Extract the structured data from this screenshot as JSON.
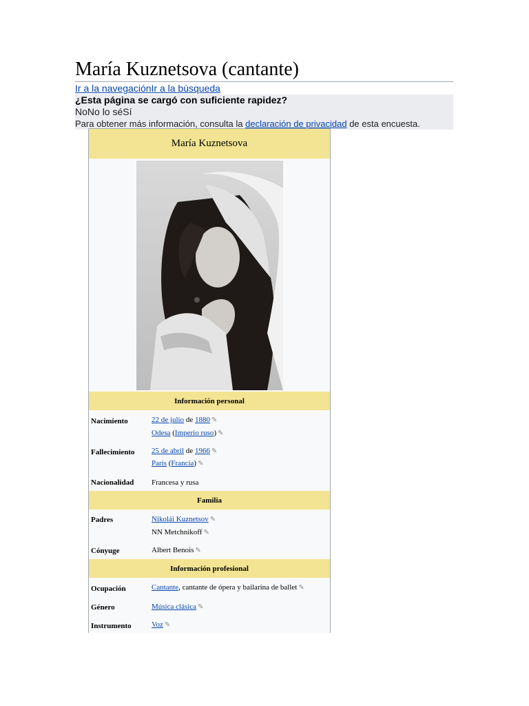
{
  "page": {
    "title": "María Kuznetsova (cantante)",
    "skip_nav": "Ir a la navegación",
    "skip_search": "Ir a la búsqueda"
  },
  "survey": {
    "question": "¿Esta página se cargó con suficiente rapidez?",
    "options": [
      "No",
      "No lo sé",
      "Sí"
    ],
    "note_before": "Para obtener más información, consulta la ",
    "note_link": "declaración de privacidad",
    "note_after": " de esta encuesta."
  },
  "infobox": {
    "title": "María Kuznetsova",
    "sections": {
      "personal": "Información personal",
      "family": "Familia",
      "professional": "Información profesional"
    },
    "nacimiento": {
      "label": "Nacimiento",
      "date_link": "22 de julio",
      "date_sep": " de ",
      "year_link": "1880",
      "place_link": "Odesa",
      "place_open": " (",
      "country_link": "Imperio ruso",
      "place_close": ")"
    },
    "fallecimiento": {
      "label": "Fallecimiento",
      "date_link": "25 de abril",
      "date_sep": " de ",
      "year_link": "1966",
      "place_link": "París",
      "place_open": " (",
      "country_link": "Francia",
      "place_close": ")"
    },
    "nacionalidad": {
      "label": "Nacionalidad",
      "value": "Francesa y rusa"
    },
    "padres": {
      "label": "Padres",
      "father_link": "Nikolái Kuznetsov",
      "mother": "NN Metchnikoff"
    },
    "conyuge": {
      "label": "Cónyuge",
      "value": "Albert Benois"
    },
    "ocupacion": {
      "label": "Ocupación",
      "link": "Cantante",
      "rest": ", cantante de ópera y bailarina de ballet"
    },
    "genero": {
      "label": "Género",
      "link": "Música clásica"
    },
    "instrumento": {
      "label": "Instrumento",
      "link": "Voz"
    }
  },
  "colors": {
    "link": "#0645ad",
    "infobox_header": "#f2e492",
    "survey_bg": "#eaecf0"
  },
  "icons": {
    "edit": "pencil-icon"
  }
}
